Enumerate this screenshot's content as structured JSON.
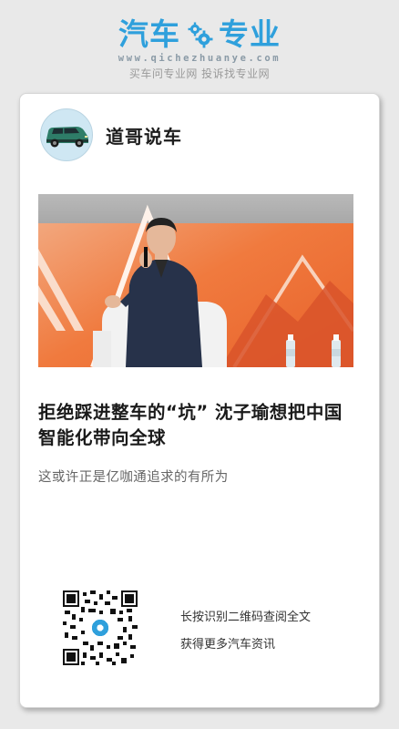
{
  "brand": {
    "logo_left": "汽车",
    "logo_right": "专业",
    "url": "www.qichezhuanye.com",
    "slogan": "买车问专业网 投诉找专业网",
    "color": "#2fa0dc"
  },
  "card": {
    "author": {
      "name": "道哥说车",
      "avatar_icon": "car-avatar-icon"
    },
    "image": {
      "description_icon": "speaker-photo"
    },
    "headline": "拒绝踩进整车的“坑” 沈子瑜想把中国智能化带向全球",
    "subtitle": "这或许正是亿咖通追求的有所为",
    "qr": {
      "icon": "qr-code-icon",
      "line1": "长按识别二维码查阅全文",
      "line2": "获得更多汽车资讯"
    }
  }
}
